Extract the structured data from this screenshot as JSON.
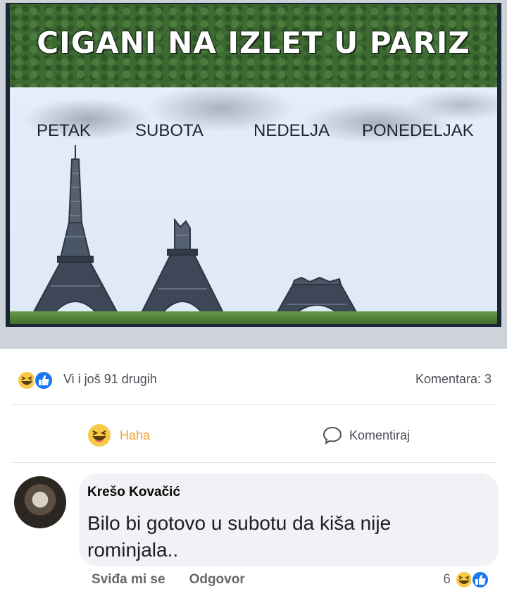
{
  "meme": {
    "title": "CIGANI NA IZLET U PARIZ",
    "days": [
      "PETAK",
      "SUBOTA",
      "NEDELJA",
      "PONEDELJAK"
    ]
  },
  "post": {
    "reactions_text": "Vi i još 91 drugih",
    "comments_count": "Komentara: 3",
    "haha_label": "Haha",
    "comment_label": "Komentiraj"
  },
  "comment": {
    "author": "Krešo Kovačić",
    "text": "Bilo bi gotovo u subotu da kiša nije rominjala..",
    "like_label": "Sviđa mi se",
    "reply_label": "Odgovor",
    "reaction_count": "6"
  },
  "icons": {
    "haha": "haha-emoji-icon",
    "like": "like-thumb-icon",
    "comment": "comment-bubble-icon"
  },
  "colors": {
    "haha": "#f0a23a",
    "like_blue": "#1877f2",
    "text_gray": "#65676b",
    "bubble": "#f0f2f5"
  }
}
